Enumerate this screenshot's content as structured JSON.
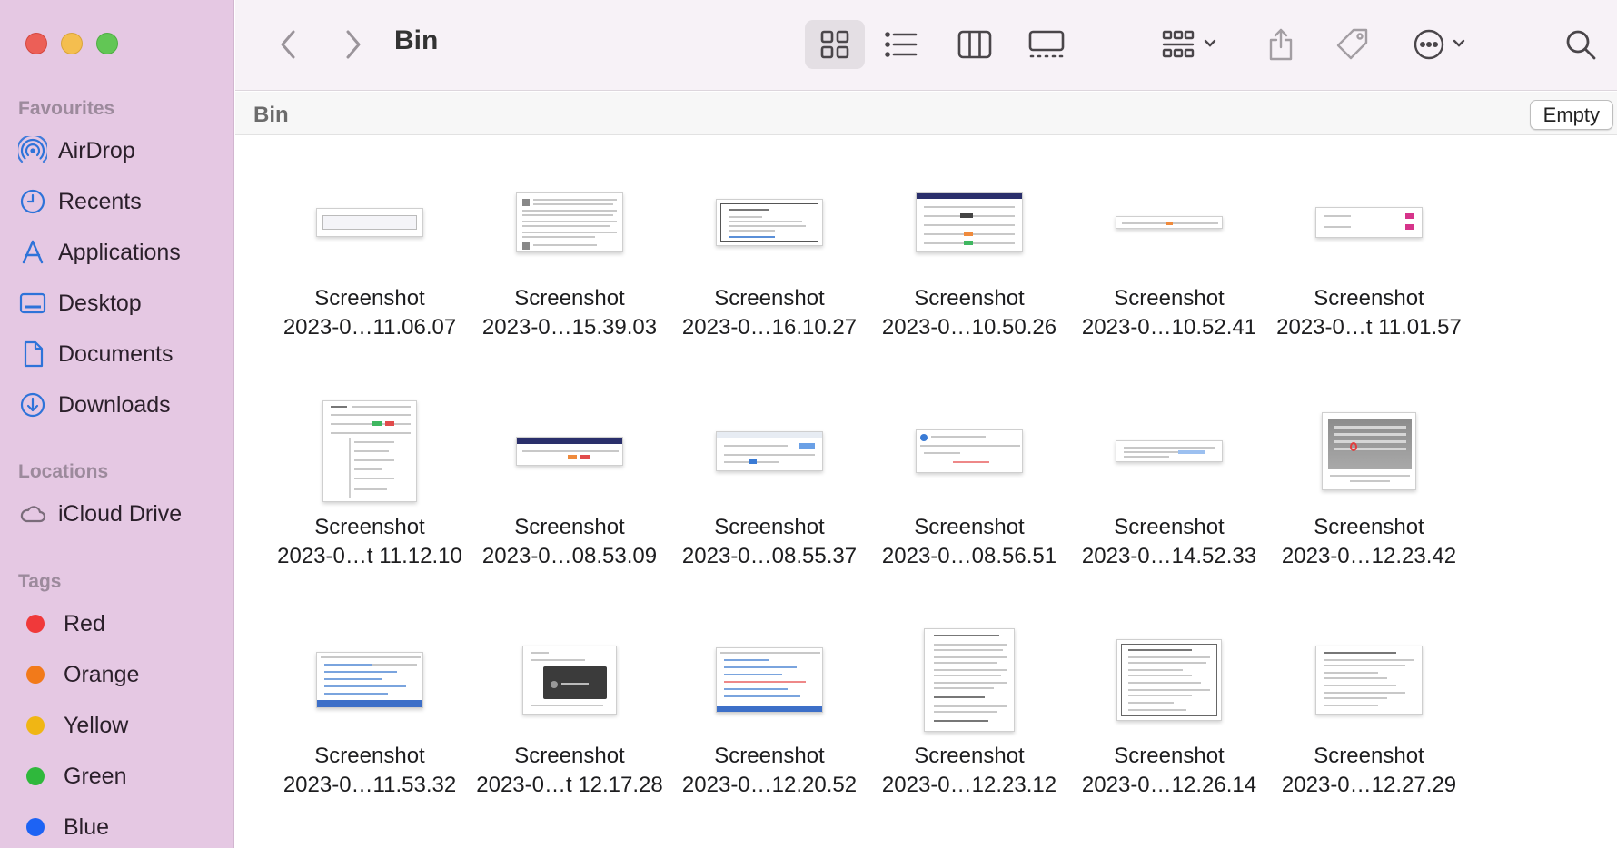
{
  "window": {
    "title": "Bin",
    "path": "Bin",
    "empty_label": "Empty"
  },
  "toolbar": {
    "icons": [
      "back-icon",
      "forward-icon",
      "icon-view-icon",
      "list-view-icon",
      "column-view-icon",
      "gallery-view-icon",
      "group-icon",
      "share-icon",
      "tag-icon",
      "more-icon",
      "search-icon"
    ]
  },
  "sidebar": {
    "favourites_title": "Favourites",
    "favourites": [
      {
        "label": "AirDrop",
        "icon": "airdrop-icon"
      },
      {
        "label": "Recents",
        "icon": "clock-icon"
      },
      {
        "label": "Applications",
        "icon": "applications-icon"
      },
      {
        "label": "Desktop",
        "icon": "desktop-icon"
      },
      {
        "label": "Documents",
        "icon": "document-icon"
      },
      {
        "label": "Downloads",
        "icon": "download-icon"
      }
    ],
    "locations_title": "Locations",
    "locations": [
      {
        "label": "iCloud Drive",
        "icon": "cloud-icon"
      }
    ],
    "tags_title": "Tags",
    "tags": [
      {
        "label": "Red",
        "color": "#f0393a"
      },
      {
        "label": "Orange",
        "color": "#f27a1a"
      },
      {
        "label": "Yellow",
        "color": "#f0b614"
      },
      {
        "label": "Green",
        "color": "#2fb83c"
      },
      {
        "label": "Blue",
        "color": "#1d63f4"
      }
    ]
  },
  "files": [
    {
      "line1": "Screenshot",
      "line2": "2023-0…11.06.07"
    },
    {
      "line1": "Screenshot",
      "line2": "2023-0…15.39.03"
    },
    {
      "line1": "Screenshot",
      "line2": "2023-0…16.10.27"
    },
    {
      "line1": "Screenshot",
      "line2": "2023-0…10.50.26"
    },
    {
      "line1": "Screenshot",
      "line2": "2023-0…10.52.41"
    },
    {
      "line1": "Screenshot",
      "line2": "2023-0…t 11.01.57"
    },
    {
      "line1": "Screenshot",
      "line2": "2023-0…t 11.12.10"
    },
    {
      "line1": "Screenshot",
      "line2": "2023-0…08.53.09"
    },
    {
      "line1": "Screenshot",
      "line2": "2023-0…08.55.37"
    },
    {
      "line1": "Screenshot",
      "line2": "2023-0…08.56.51"
    },
    {
      "line1": "Screenshot",
      "line2": "2023-0…14.52.33"
    },
    {
      "line1": "Screenshot",
      "line2": "2023-0…12.23.42"
    },
    {
      "line1": "Screenshot",
      "line2": "2023-0…11.53.32"
    },
    {
      "line1": "Screenshot",
      "line2": "2023-0…t 12.17.28"
    },
    {
      "line1": "Screenshot",
      "line2": "2023-0…12.20.52"
    },
    {
      "line1": "Screenshot",
      "line2": "2023-0…12.23.12"
    },
    {
      "line1": "Screenshot",
      "line2": "2023-0…12.26.14"
    },
    {
      "line1": "Screenshot",
      "line2": "2023-0…12.27.29"
    }
  ]
}
